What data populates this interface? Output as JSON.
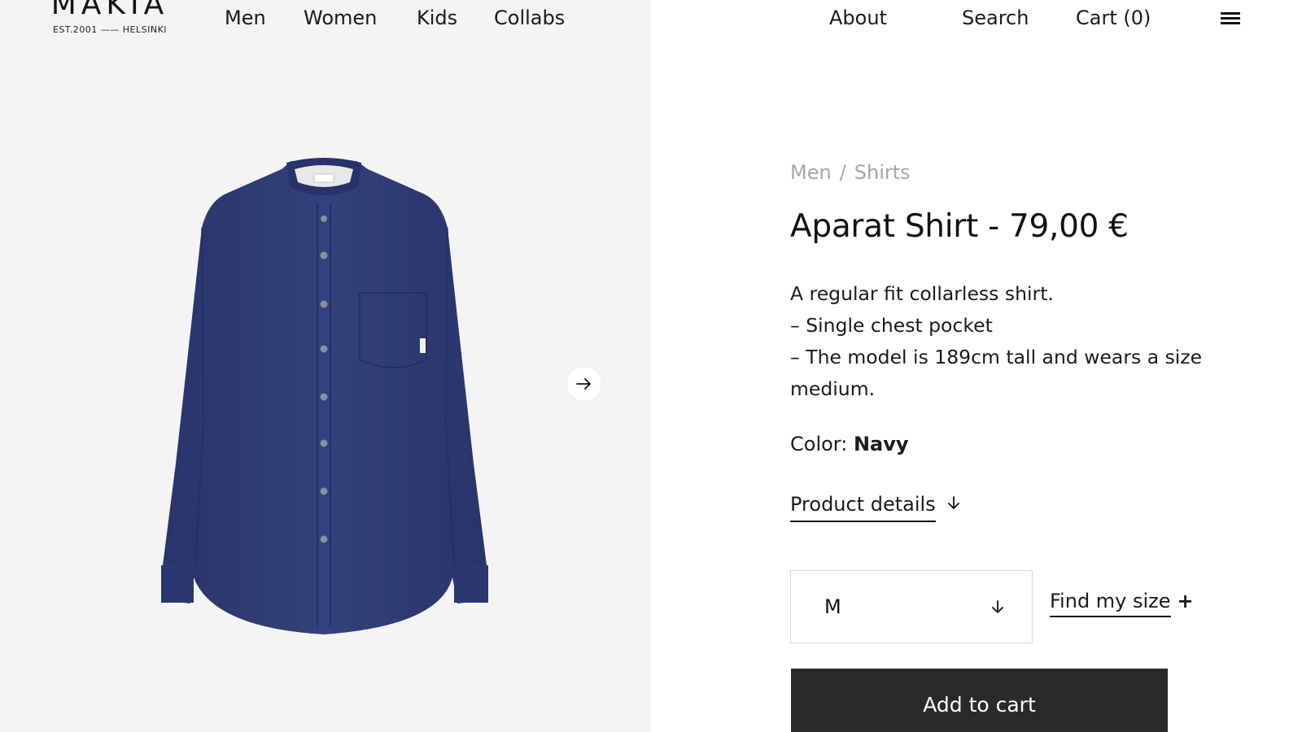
{
  "brand": {
    "name": "MAKIA",
    "tagline": "EST.2001 —— HELSINKI"
  },
  "nav": {
    "main": [
      "Men",
      "Women",
      "Kids",
      "Collabs"
    ],
    "about": "About",
    "search": "Search",
    "cart": "Cart (0)"
  },
  "icons": {
    "menu": "hamburger-icon",
    "carousel_next": "arrow-right-icon",
    "details_toggle": "arrow-down-icon",
    "size_select": "arrow-down-icon"
  },
  "product": {
    "breadcrumb": [
      "Men",
      "Shirts"
    ],
    "breadcrumb_separator": "/",
    "title": "Aparat Shirt - 79,00 €",
    "description": [
      "A regular fit collarless shirt.",
      "– Single chest pocket",
      "– The model is 189cm tall and wears a size medium."
    ],
    "color_label": "Color:",
    "color_value": "Navy",
    "details_label": "Product details",
    "size_selected": "M",
    "find_size_label": "Find my size",
    "find_size_plus": "+",
    "add_to_cart": "Add to cart"
  },
  "colors": {
    "shirt": "#2e3b73",
    "image_bg": "#f4f4f4",
    "button_bg": "#2a2a2a",
    "breadcrumb": "#a6a6a6"
  }
}
